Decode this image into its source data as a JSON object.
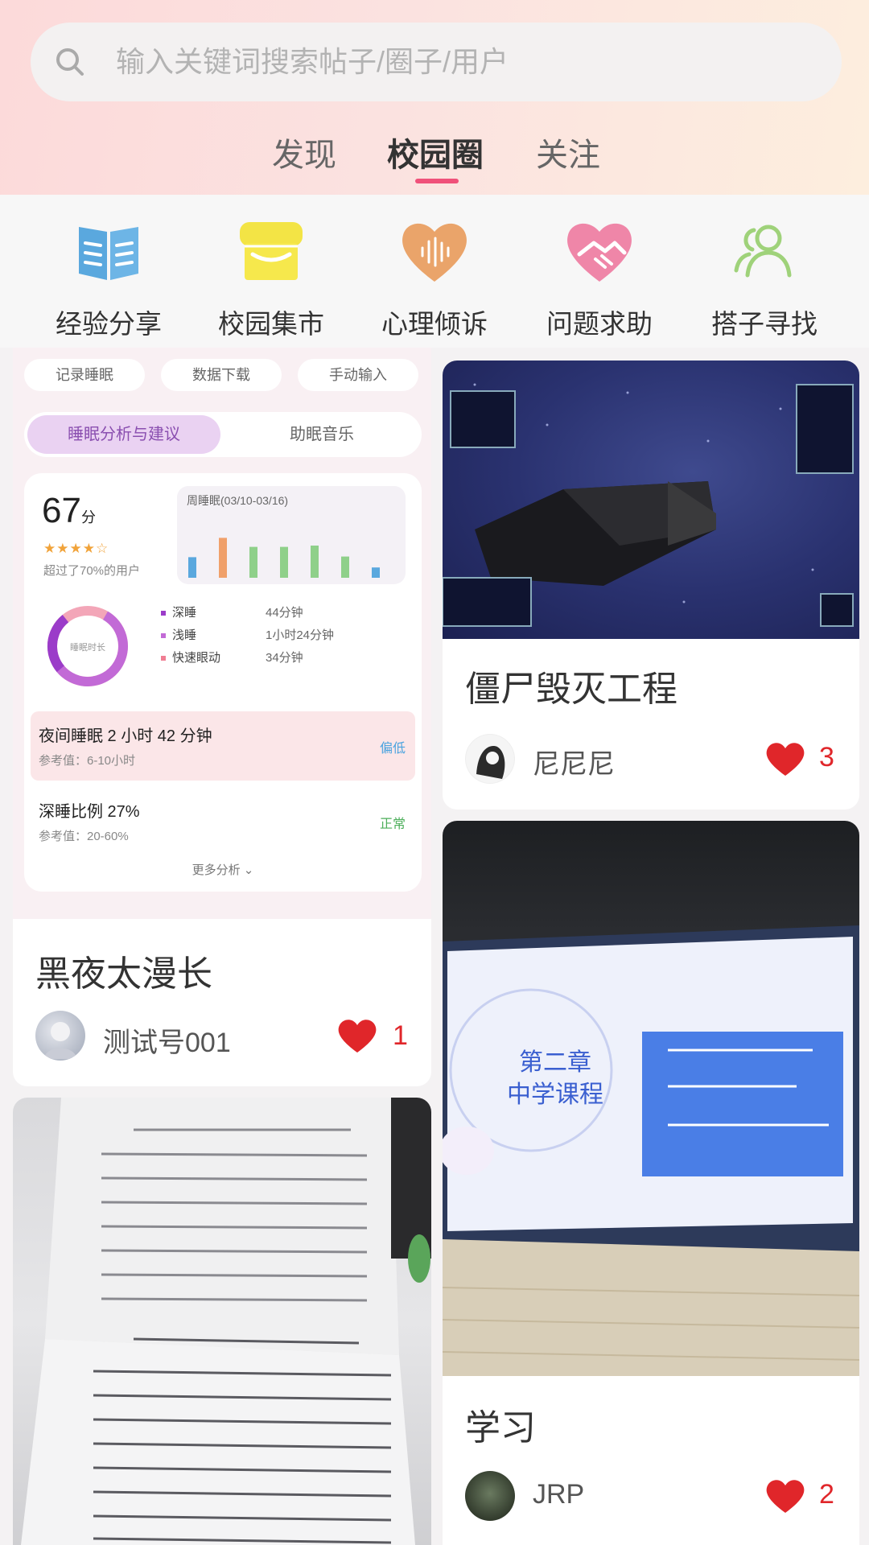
{
  "search": {
    "placeholder": "输入关键词搜索帖子/圈子/用户"
  },
  "tabs": [
    {
      "label": "发现"
    },
    {
      "label": "校园圈"
    },
    {
      "label": "关注"
    }
  ],
  "active_tab": "校园圈",
  "categories": [
    {
      "label": "经验分享",
      "icon": "book-icon",
      "color": "#5aa8de"
    },
    {
      "label": "校园集市",
      "icon": "shop-icon",
      "color": "#f3e445"
    },
    {
      "label": "心理倾诉",
      "icon": "heart-voice-icon",
      "color": "#eaa46a"
    },
    {
      "label": "问题求助",
      "icon": "handshake-icon",
      "color": "#ef86a8"
    },
    {
      "label": "搭子寻找",
      "icon": "people-icon",
      "color": "#9fd27a"
    }
  ],
  "posts": [
    {
      "title": "黑夜太漫长",
      "author": "测试号001",
      "likes": "1",
      "image": "sleep-analysis-screenshot",
      "analysis": {
        "chips": [
          "记录睡眠",
          "数据下载",
          "手动输入"
        ],
        "segments": [
          "睡眠分析与建议",
          "助眠音乐"
        ],
        "score": "67",
        "score_unit": "分",
        "stars": "★★★★☆",
        "beat_text": "超过了70%的用户",
        "week_title": "周睡眠(03/10-03/16)",
        "week_bars": [
          0.32,
          0.62,
          0.48,
          0.48,
          0.5,
          0.33,
          0.16
        ],
        "ring_label": "睡眠时长",
        "legend": [
          {
            "label": "深睡",
            "value": "44分钟",
            "color": "#9b3cc9"
          },
          {
            "label": "浅睡",
            "value": "1小时24分钟",
            "color": "#c26ad6"
          },
          {
            "label": "快速眼动",
            "value": "34分钟",
            "color": "#f07e93"
          }
        ],
        "row1_main": "夜间睡眠 2 小时 42 分钟",
        "row1_sub": "参考值：6-10小时",
        "row1_tag": "偏低",
        "row2_main": "深睡比例 27%",
        "row2_sub": "参考值：20-60%",
        "row2_tag": "正常",
        "more": "更多分析"
      }
    },
    {
      "title": "僵尸毁灭工程",
      "author": "尼尼尼",
      "likes": "3",
      "image": "game-screenshot"
    },
    {
      "title": "学习",
      "author": "JRP",
      "likes": "2",
      "image": "laptop-lesson-photo",
      "slide": {
        "heading_line1": "第二章",
        "heading_line2": "中学课程"
      }
    },
    {
      "image": "document-paper-photo"
    }
  ],
  "colors": {
    "accent": "#f0517a",
    "like": "#e0262a"
  }
}
